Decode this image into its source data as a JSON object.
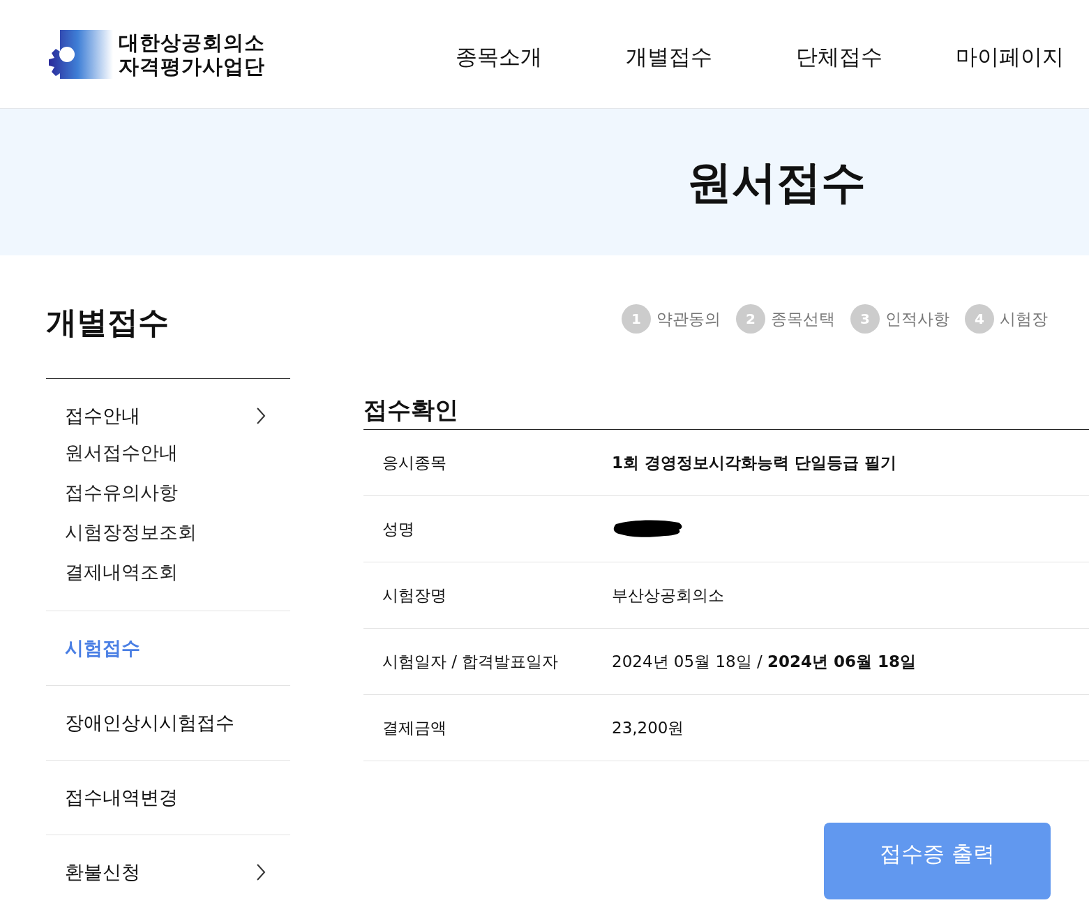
{
  "header": {
    "logo_lines": [
      "대한상공회의소",
      "자격평가사업단"
    ],
    "nav": [
      "종목소개",
      "개별접수",
      "단체접수",
      "마이페이지"
    ]
  },
  "banner": {
    "title": "원서접수"
  },
  "sidebar": {
    "title": "개별접수",
    "groups": [
      {
        "label": "접수안내",
        "selected": false,
        "has_arrow": true,
        "children": [
          {
            "label": "원서접수안내"
          },
          {
            "label": "접수유의사항"
          },
          {
            "label": "시험장정보조회"
          },
          {
            "label": "결제내역조회"
          }
        ]
      },
      {
        "label": "시험접수",
        "selected": true,
        "has_arrow": false
      },
      {
        "label": "장애인상시시험접수",
        "selected": false,
        "has_arrow": false
      },
      {
        "label": "접수내역변경",
        "selected": false,
        "has_arrow": false
      },
      {
        "label": "환불신청",
        "selected": false,
        "has_arrow": true
      }
    ]
  },
  "steps": [
    {
      "number": "1",
      "label": "약관동의"
    },
    {
      "number": "2",
      "label": "종목선택"
    },
    {
      "number": "3",
      "label": "인적사항"
    },
    {
      "number": "4",
      "label": "시험장"
    }
  ],
  "section_title": "접수확인",
  "details": [
    {
      "label": "응시종목",
      "value": "1회 경영정보시각화능력 단일등급 필기",
      "bold": true
    },
    {
      "label": "성명",
      "redacted": true
    },
    {
      "label": "시험장명",
      "value": "부산상공회의소",
      "bold": false
    },
    {
      "label": "시험일자 / 합격발표일자",
      "value": "2024년 05월 18일 / **2024년 06월 18일**",
      "bold": false
    },
    {
      "label": "결제금액",
      "value": "23,200원",
      "bold": false
    }
  ],
  "buttons": [
    "접수증 출력"
  ]
}
